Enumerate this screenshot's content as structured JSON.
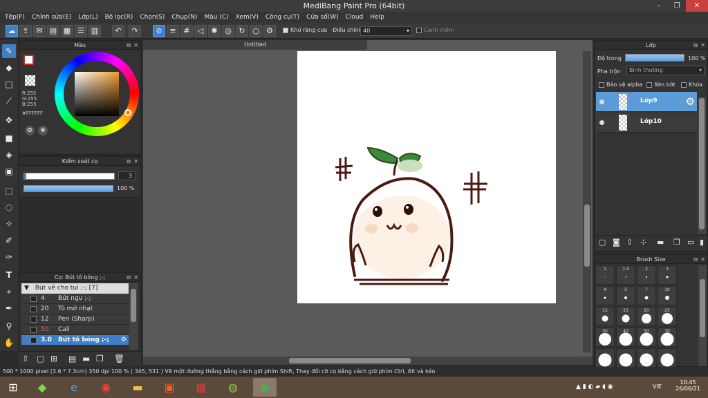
{
  "app": {
    "title": "MediBang Paint Pro (64bit)"
  },
  "window": {
    "min": "–",
    "max": "❐",
    "close": "✕"
  },
  "menu": [
    "Tệp(F)",
    "Chỉnh sửa(E)",
    "Lớp(L)",
    "Bộ lọc(R)",
    "Chọn(S)",
    "Chụp(N)",
    "Màu (C)",
    "Xem(V)",
    "Công cụ(T)",
    "Cửa số(W)",
    "Cloud",
    "Help"
  ],
  "toolbar": {
    "antialias_label": "Khử răng cưa",
    "adjust_label": "Điều chỉnh",
    "adjust_value": "40",
    "snap_label": "Canh mềm"
  },
  "color_panel": {
    "title": "Màu",
    "r": "R:255",
    "g": "G:255",
    "b": "B:255",
    "hex": "#FFFFFF"
  },
  "brush_control": {
    "title": "Kiểm soát cọ",
    "size_value": "3",
    "opacity_value": "100 %",
    "size_fraction": 0.02,
    "opacity_fraction": 1.0
  },
  "brush_panel": {
    "title": "Cọ: Bút tô bóng ;-;",
    "group": "Bút vẽ cho tui ;-; [7]",
    "items": [
      {
        "size": "4",
        "name": "Bút ngu ;-;",
        "selected": false
      },
      {
        "size": "20",
        "name": "Tô mờ nhạt",
        "selected": false
      },
      {
        "size": "12",
        "name": "Pen (Sharp)",
        "selected": false
      },
      {
        "size": "50",
        "name": "Cali",
        "selected": false,
        "size_color": "#e06060"
      },
      {
        "size": "3.0",
        "name": "Bút tô bóng ;-;",
        "selected": true
      }
    ]
  },
  "document": {
    "tab": "Untitled"
  },
  "layer_panel": {
    "title": "Lớp",
    "opacity_label": "Độ trong",
    "opacity_value": "100 %",
    "blend_label": "Pha trộn",
    "blend_value": "Bình thường",
    "protect_alpha": "Bảo vệ alpha",
    "clipping": "Xén bớt",
    "lock": "Khóa",
    "layers": [
      {
        "name": "Lớp9",
        "selected": true
      },
      {
        "name": "Lớp10",
        "selected": false
      }
    ]
  },
  "brush_size_panel": {
    "title": "Brush Size",
    "sizes": [
      "1",
      "1.5",
      "2",
      "3",
      "4",
      "5",
      "7",
      "10",
      "12",
      "15",
      "20",
      "25",
      "30",
      "40",
      "50",
      "70",
      "",
      "",
      "",
      ""
    ]
  },
  "status": {
    "text": "500 * 1000 pixel   (3.6 * 7.3cm)   350 dpi   100 %   ( 345, 531 )   Vẽ một đường thẳng bằng cách giữ phím Shift, Thay đổi cỡ cọ bằng cách giữ phím Ctrl, Alt và kéo"
  },
  "taskbar": {
    "lang": "VIE",
    "time": "10:45",
    "date": "26/06/21"
  },
  "colors": {
    "accent": "#3f7fc6",
    "drawing_line": "#4a1a10",
    "leaf": "#3a8a3a",
    "blush": "#f6d9c4"
  }
}
